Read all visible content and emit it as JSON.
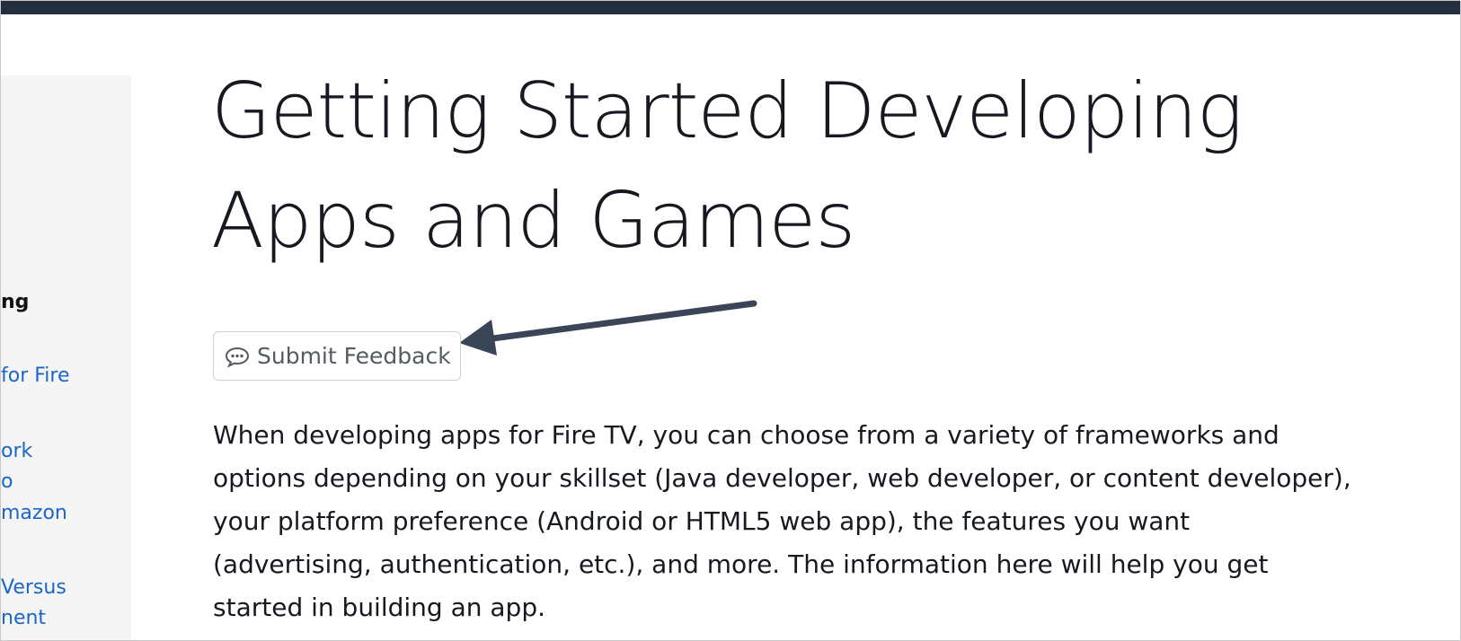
{
  "sidebar": {
    "items": [
      {
        "label": "ng",
        "kind": "heading"
      },
      {
        "label": "for Fire",
        "kind": "link"
      },
      {
        "label": "ork",
        "kind": "link"
      },
      {
        "label": "o",
        "kind": "link"
      },
      {
        "label": "mazon",
        "kind": "link"
      },
      {
        "label": "Versus",
        "kind": "link"
      },
      {
        "label": "nent",
        "kind": "link"
      }
    ]
  },
  "main": {
    "title_line1": "Getting Started Developing",
    "title_line2": "Apps and Games",
    "feedback_button": {
      "label": "Submit Feedback",
      "icon": "speech-bubble-icon"
    },
    "intro": "When developing apps for Fire TV, you can choose from a variety of frameworks and options depending on your skillset (Java developer, web developer, or content developer), your platform preference (Android or HTML5 web app), the features you want (advertising, authentication, etc.), and more. The information here will help you get started in building an app."
  },
  "colors": {
    "topbar": "#232f3e",
    "link": "#1a66c9",
    "sidebar_bg": "#f5f5f5",
    "annotation_arrow": "#3a4658"
  }
}
